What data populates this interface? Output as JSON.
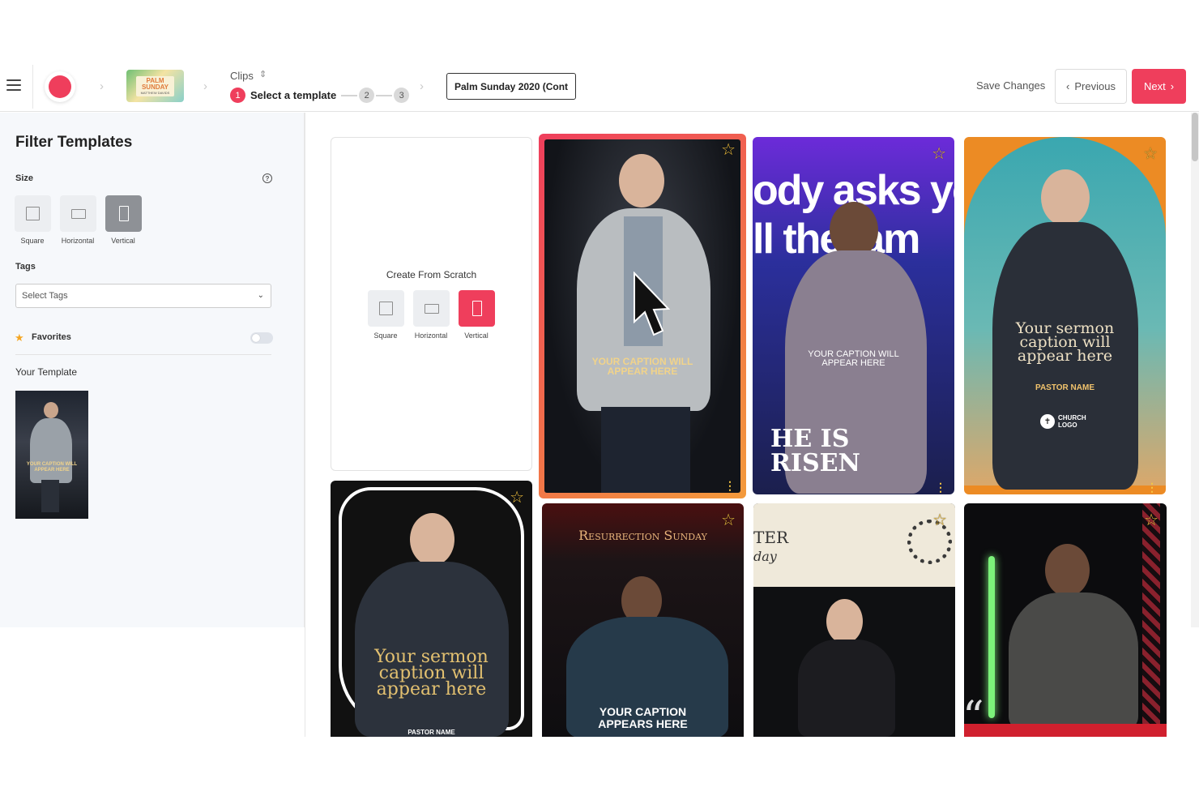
{
  "topbar": {
    "menu_icon": "hamburger-icon",
    "record_icon": "record-icon",
    "palm_thumb": {
      "line1": "PALM",
      "line2": "SUNDAY",
      "line3": "MATTHEW DAVIDS"
    },
    "clips_label": "Clips",
    "steps": [
      {
        "number": "1",
        "label": "Select a template",
        "active": true
      },
      {
        "number": "2",
        "label": "",
        "active": false
      },
      {
        "number": "3",
        "label": "",
        "active": false
      }
    ],
    "project_name": "Palm Sunday 2020 (Cont",
    "save_changes": "Save Changes",
    "previous_label": "Previous",
    "next_label": "Next",
    "accent_color": "#ef3e5c"
  },
  "sidebar": {
    "title": "Filter Templates",
    "size_label": "Size",
    "size_options": [
      {
        "label": "Square",
        "icon": "square-icon",
        "selected": false
      },
      {
        "label": "Horizontal",
        "icon": "horizontal-icon",
        "selected": false
      },
      {
        "label": "Vertical",
        "icon": "vertical-icon",
        "selected": true
      }
    ],
    "tags_label": "Tags",
    "tags_placeholder": "Select Tags",
    "favorites_label": "Favorites",
    "favorites_on": false,
    "your_template_label": "Your Template",
    "your_template_caption": "YOUR CAPTION WILL APPEAR HERE"
  },
  "scratch": {
    "title": "Create From Scratch",
    "options": [
      {
        "label": "Square",
        "selected": false
      },
      {
        "label": "Horizontal",
        "selected": false
      },
      {
        "label": "Vertical",
        "selected": true
      }
    ]
  },
  "templates": [
    {
      "caption": "YOUR CAPTION WILL APPEAR HERE",
      "selected": true
    },
    {
      "top_text": "ody asks yo",
      "top_text2": "ll the lam",
      "caption": "YOUR CAPTION WILL APPEAR HERE",
      "title": "HE IS RISEN"
    },
    {
      "caption": "Your sermon caption will appear here",
      "pastor": "PASTOR NAME",
      "church": "CHURCH LOGO"
    },
    {
      "caption": "Your sermon caption will appear here",
      "pastor": "PASTOR NAME"
    },
    {
      "header": "Resurrection Sunday",
      "caption": "YOUR CAPTION APPEARS HERE"
    },
    {
      "header": "TER",
      "header2": "day"
    },
    {
      "quote": "“"
    }
  ]
}
